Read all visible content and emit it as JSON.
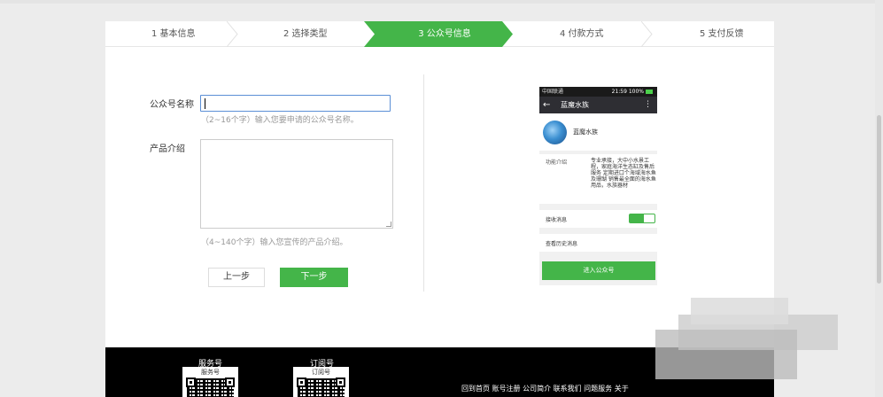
{
  "steps": [
    {
      "label": "1 基本信息"
    },
    {
      "label": "2 选择类型"
    },
    {
      "label": "3 公众号信息"
    },
    {
      "label": "4 付款方式"
    },
    {
      "label": "5 支付反馈"
    }
  ],
  "form": {
    "name_label": "公众号名称",
    "name_value": "",
    "name_hint": "（2~16个字）输入您要申请的公众号名称。",
    "intro_label": "产品介绍",
    "intro_value": "",
    "intro_hint": "（4~140个字）输入您宣传的产品介绍。",
    "prev_label": "上一步",
    "next_label": "下一步"
  },
  "preview": {
    "carrier": "中国联通",
    "time_battery": "21:59 100%",
    "back_icon": "arrow-left-icon",
    "header_title": "蓝魔水族",
    "more_icon": "more-vertical-icon",
    "account_name": "蓝魔水族",
    "intro_label": "功能介绍",
    "intro_text": "专业承接，大中小水景工程，家庭海洋生态缸及售后服务 定期进口个海域海水鱼及珊瑚 销售最全面的海水鱼用品，水族器材",
    "receive_label": "接收消息",
    "receive_enabled": true,
    "history_label": "查看历史消息",
    "enter_label": "进入公众号"
  },
  "footer": {
    "service_title": "服务号",
    "service_caption": "服务号",
    "subscribe_title": "订阅号",
    "subscribe_caption": "订阅号",
    "links": "回到首页 账号注册 公司简介 联系我们 问题服务 关于"
  },
  "colors": {
    "accent": "#44b549",
    "footer_bg": "#000000",
    "input_focus": "#5b8fd6"
  }
}
